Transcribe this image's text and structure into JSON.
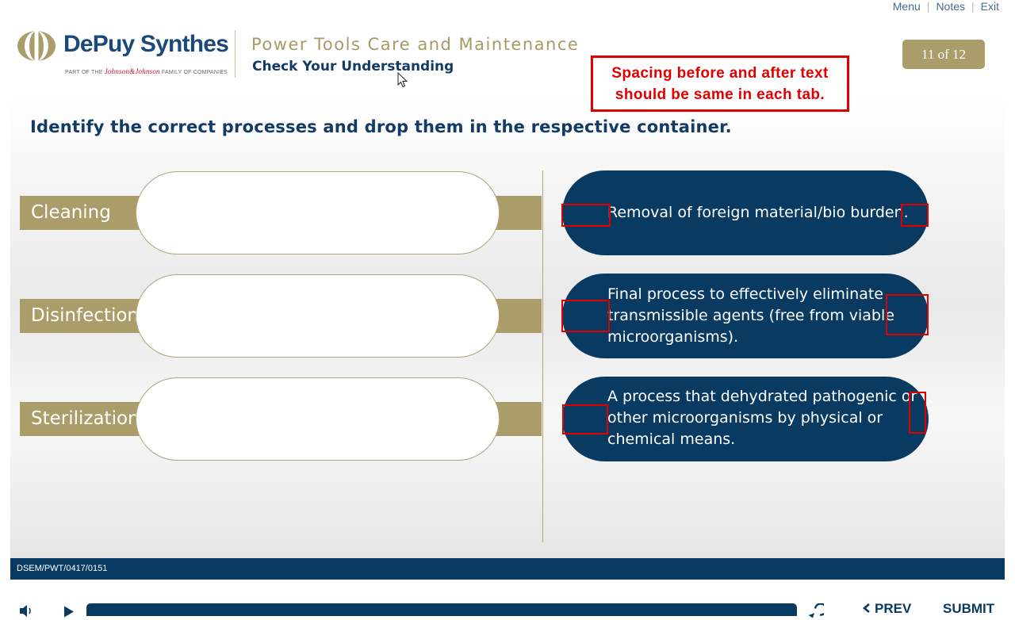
{
  "top_links": {
    "menu": "Menu",
    "notes": "Notes",
    "exit": "Exit",
    "separator": "|"
  },
  "brand": {
    "name": "DePuy Synthes",
    "tagline_prefix": "PART OF THE",
    "tagline_brand": "Johnson&Johnson",
    "tagline_suffix": "FAMILY OF COMPANIES"
  },
  "header": {
    "course_title": "Power Tools Care and Maintenance",
    "section_title": "Check Your Understanding",
    "page_indicator": "11 of 12"
  },
  "review_note": {
    "line1": "Spacing before and after text",
    "line2": "should be same in each tab."
  },
  "question": "Identify the correct processes and drop them in the respective container.",
  "targets": [
    {
      "label": "Cleaning"
    },
    {
      "label": "Disinfection"
    },
    {
      "label": "Sterilization"
    }
  ],
  "options": [
    {
      "lines": [
        "Removal of foreign material/bio burden."
      ]
    },
    {
      "lines": [
        "Final process to effectively eliminate",
        "transmissible agents (free from viable",
        "microorganisms)."
      ]
    },
    {
      "lines": [
        "A process that dehydrated pathogenic or",
        "other microorganisms by physical or",
        "chemical means."
      ]
    }
  ],
  "footer": {
    "code": "DSEM/PWT/0417/0151"
  },
  "player": {
    "prev_label": "PREV",
    "submit_label": "SUBMIT",
    "progress": 0
  },
  "colors": {
    "navy": "#083a62",
    "gold": "#ab9d69",
    "annotation_red": "#e00000"
  },
  "icons": [
    "volume-icon",
    "play-icon",
    "replay-icon",
    "chevron-left-icon",
    "cursor-icon"
  ]
}
